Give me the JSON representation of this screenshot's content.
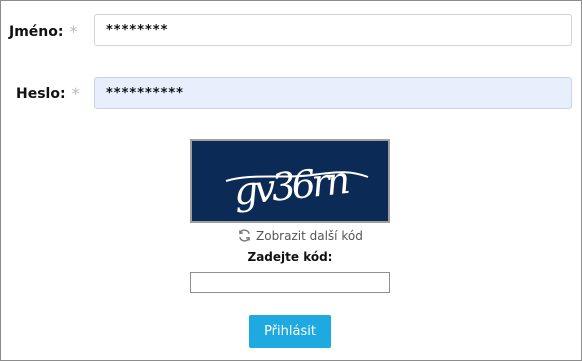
{
  "form": {
    "username": {
      "label": "Jméno:",
      "required_mark": "*",
      "value": "********"
    },
    "password": {
      "label": "Heslo:",
      "required_mark": "*",
      "value": "**********"
    },
    "captcha": {
      "image_text": "gv36rn",
      "refresh_label": "Zobrazit další kód",
      "refresh_icon": "refresh-icon",
      "code_label": "Zadejte kód:",
      "code_value": ""
    },
    "submit_label": "Přihlásit"
  },
  "colors": {
    "captcha_background": "#0b2a55",
    "password_field_background": "#e8eefb",
    "submit_background": "#1ea9e1"
  }
}
